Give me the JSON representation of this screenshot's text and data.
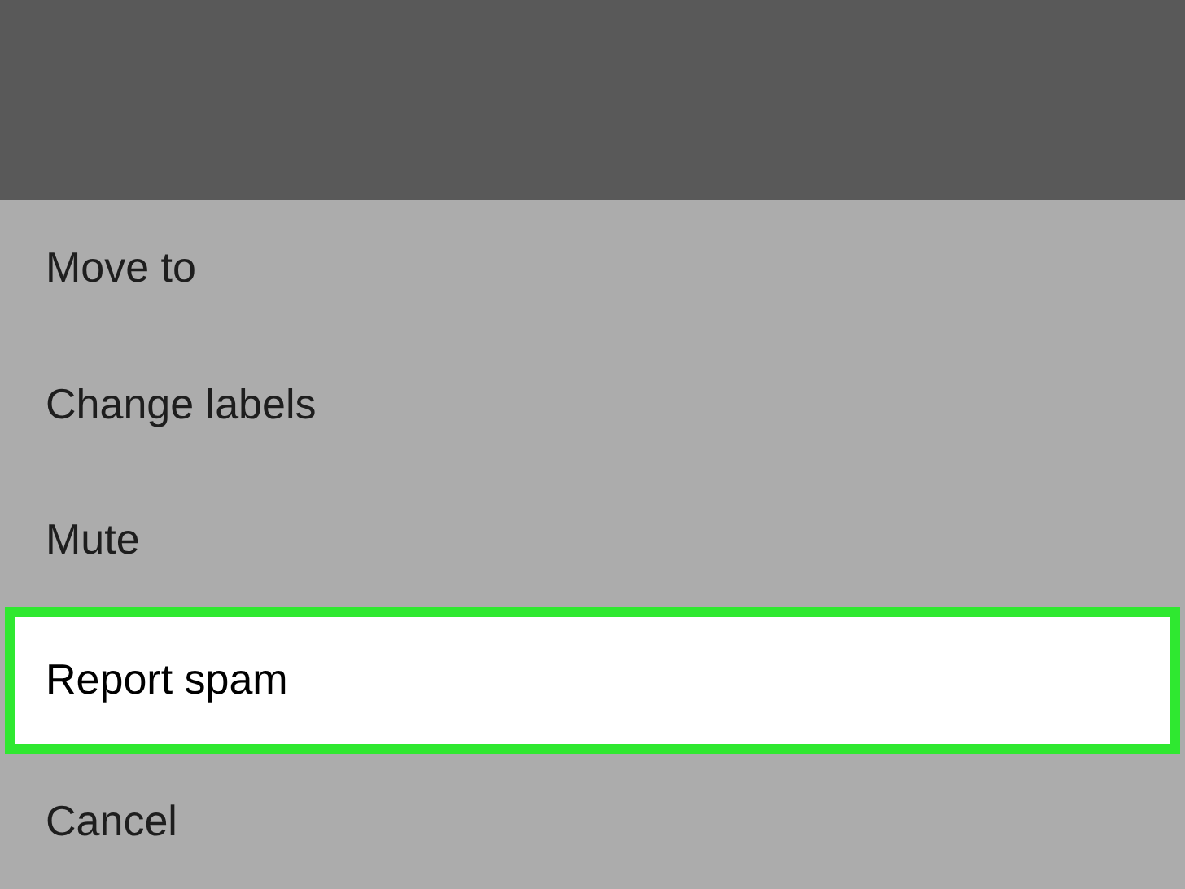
{
  "action_sheet": {
    "items": [
      {
        "label": "Move to",
        "selected": false
      },
      {
        "label": "Change labels",
        "selected": false
      },
      {
        "label": "Mute",
        "selected": false
      },
      {
        "label": "Report spam",
        "selected": true
      },
      {
        "label": "Cancel",
        "selected": false
      }
    ]
  }
}
